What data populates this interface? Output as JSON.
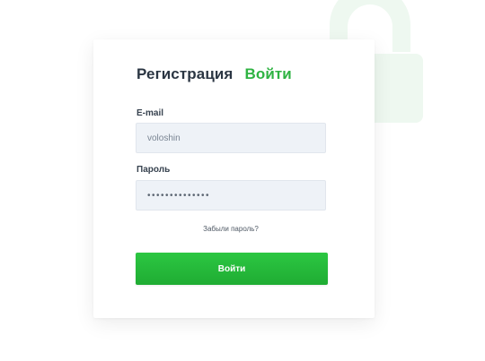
{
  "tabs": {
    "register": "Регистрация",
    "login": "Войти"
  },
  "form": {
    "email_label": "E-mail",
    "email_value": "voloshin",
    "password_label": "Пароль",
    "password_value": "••••••••••••••",
    "forgot_link": "Забыли пароль?",
    "submit_label": "Войти"
  },
  "colors": {
    "accent": "#2eb342",
    "lock_tint": "#eef8f0"
  },
  "icons": {
    "background_lock": "lock-open-icon"
  }
}
